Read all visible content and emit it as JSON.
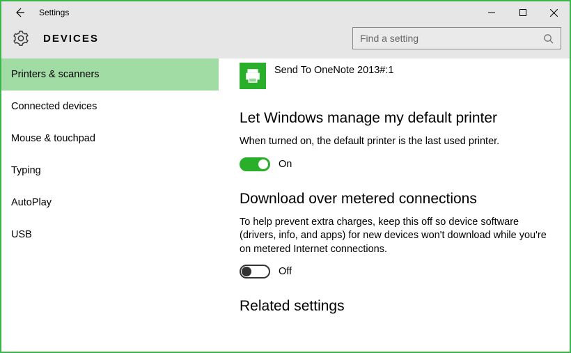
{
  "window": {
    "title": "Settings"
  },
  "header": {
    "section": "DEVICES",
    "search_placeholder": "Find a setting"
  },
  "sidebar": {
    "items": [
      {
        "label": "Printers & scanners",
        "selected": true
      },
      {
        "label": "Connected devices",
        "selected": false
      },
      {
        "label": "Mouse & touchpad",
        "selected": false
      },
      {
        "label": "Typing",
        "selected": false
      },
      {
        "label": "AutoPlay",
        "selected": false
      },
      {
        "label": "USB",
        "selected": false
      }
    ]
  },
  "main": {
    "printer": {
      "name": "Send To OneNote 2013#:1"
    },
    "default_printer": {
      "heading": "Let Windows manage my default printer",
      "desc": "When turned on, the default printer is the last used printer.",
      "toggle_on": true,
      "toggle_label": "On"
    },
    "metered": {
      "heading": "Download over metered connections",
      "desc": "To help prevent extra charges, keep this off so device software (drivers, info, and apps) for new devices won't download while you're on metered Internet connections.",
      "toggle_on": false,
      "toggle_label": "Off"
    },
    "related": {
      "heading": "Related settings"
    }
  }
}
